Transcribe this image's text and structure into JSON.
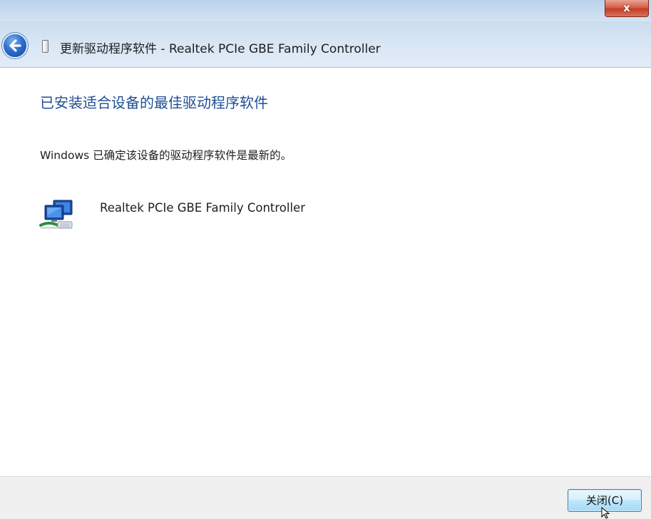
{
  "window": {
    "close_glyph": "x",
    "close_icon": "close-icon"
  },
  "nav": {
    "back_icon": "back-arrow-icon",
    "device_icon": "device-icon",
    "title": "更新驱动程序软件 - Realtek PCIe GBE Family Controller"
  },
  "content": {
    "heading": "已安装适合设备的最佳驱动程序软件",
    "message": "Windows 已确定该设备的驱动程序软件是最新的。",
    "device": {
      "icon": "network-adapter-icon",
      "name": "Realtek PCIe GBE Family Controller"
    }
  },
  "footer": {
    "close_button_label": "关闭(C)"
  },
  "colors": {
    "heading": "#1f4e96",
    "footer_bg": "#f0f0f0",
    "close_button_border": "#3c7fb1",
    "window_close": "#c43c22"
  }
}
